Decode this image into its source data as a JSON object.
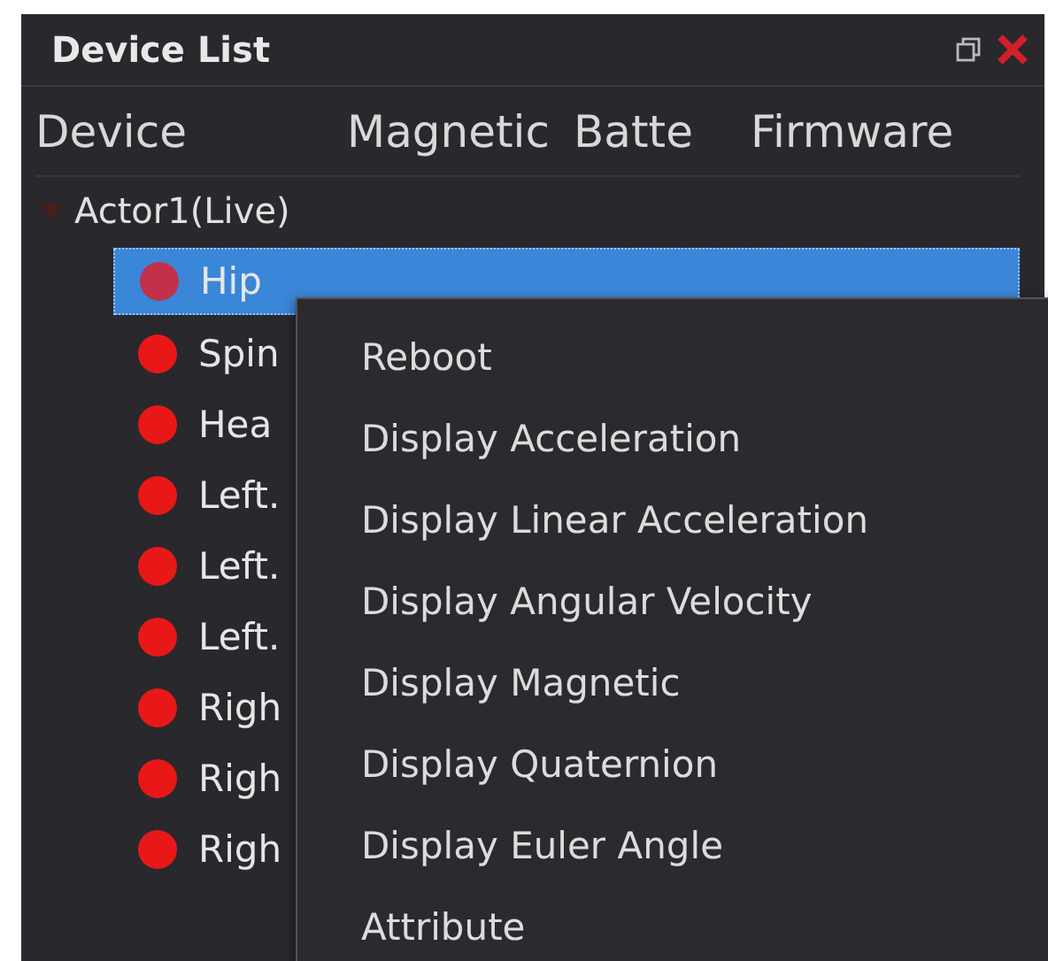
{
  "panel": {
    "title": "Device List"
  },
  "columns": [
    "Device",
    "Magnetic",
    "Batte",
    "Firmware"
  ],
  "actor": {
    "label": "Actor1(Live)",
    "expanded": true
  },
  "devices": [
    {
      "name": "Hip",
      "selected": true
    },
    {
      "name": "Spin",
      "selected": false
    },
    {
      "name": "Hea",
      "selected": false
    },
    {
      "name": "Left.",
      "selected": false
    },
    {
      "name": "Left.",
      "selected": false
    },
    {
      "name": "Left.",
      "selected": false
    },
    {
      "name": "Righ",
      "selected": false
    },
    {
      "name": "Righ",
      "selected": false
    },
    {
      "name": "Righ",
      "selected": false
    }
  ],
  "context_menu": [
    "Reboot",
    "Display Acceleration",
    "Display Linear Acceleration",
    "Display Angular Velocity",
    "Display Magnetic",
    "Display Quaternion",
    "Display Euler Angle",
    "Attribute"
  ]
}
